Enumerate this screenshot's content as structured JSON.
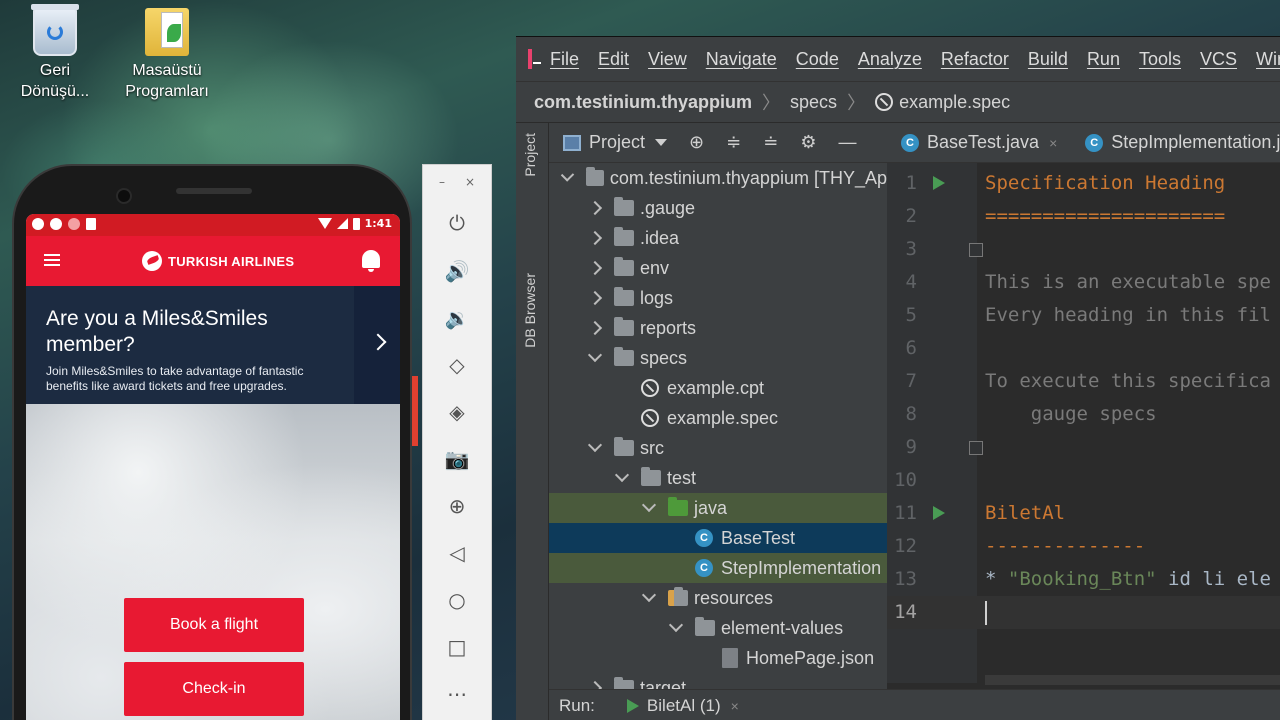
{
  "desktop": {
    "icons": [
      {
        "label_line1": "Geri",
        "label_line2": "Dönüşü...",
        "icon": "recycle-bin-icon"
      },
      {
        "label_line1": "Masaüstü",
        "label_line2": "Programları",
        "icon": "folder-icon"
      }
    ]
  },
  "phone": {
    "status_time": "1:41",
    "app_title": "TURKISH AIRLINES",
    "miles_title": "Are you a Miles&Smiles member?",
    "miles_subtitle": "Join Miles&Smiles to take advantage of fantastic benefits like award tickets and free upgrades.",
    "buttons": [
      "Book a flight",
      "Check-in"
    ]
  },
  "emulator": {
    "window_controls": [
      "–",
      "×"
    ],
    "tools": [
      "power-icon",
      "volume-up-icon",
      "volume-down-icon",
      "rotate-left-icon",
      "rotate-right-icon",
      "camera-icon",
      "zoom-icon",
      "back-icon",
      "home-icon",
      "overview-icon",
      "more-icon"
    ]
  },
  "ide": {
    "menu": [
      "File",
      "Edit",
      "View",
      "Navigate",
      "Code",
      "Analyze",
      "Refactor",
      "Build",
      "Run",
      "Tools",
      "VCS",
      "Win"
    ],
    "breadcrumb": [
      "com.testinium.thyappium",
      "specs",
      "example.spec"
    ],
    "side_tabs": [
      "Project",
      "DB Browser"
    ],
    "project_header": "Project",
    "tree": [
      {
        "label": "com.testinium.thyappium [THY_Ap",
        "indent": 0,
        "arrow": "d",
        "icon": "folder"
      },
      {
        "label": ".gauge",
        "indent": 1,
        "arrow": "r",
        "icon": "folder"
      },
      {
        "label": ".idea",
        "indent": 1,
        "arrow": "r",
        "icon": "folder"
      },
      {
        "label": "env",
        "indent": 1,
        "arrow": "r",
        "icon": "folder"
      },
      {
        "label": "logs",
        "indent": 1,
        "arrow": "r",
        "icon": "folder"
      },
      {
        "label": "reports",
        "indent": 1,
        "arrow": "r",
        "icon": "folder"
      },
      {
        "label": "specs",
        "indent": 1,
        "arrow": "d",
        "icon": "folder"
      },
      {
        "label": "example.cpt",
        "indent": 2,
        "arrow": "",
        "icon": "gauge"
      },
      {
        "label": "example.spec",
        "indent": 2,
        "arrow": "",
        "icon": "gauge"
      },
      {
        "label": "src",
        "indent": 1,
        "arrow": "d",
        "icon": "folder"
      },
      {
        "label": "test",
        "indent": 2,
        "arrow": "d",
        "icon": "folder"
      },
      {
        "label": "java",
        "indent": 3,
        "arrow": "d",
        "icon": "folder-green"
      },
      {
        "label": "BaseTest",
        "indent": 4,
        "arrow": "",
        "icon": "class"
      },
      {
        "label": "StepImplementation",
        "indent": 4,
        "arrow": "",
        "icon": "class"
      },
      {
        "label": "resources",
        "indent": 3,
        "arrow": "d",
        "icon": "folder-res"
      },
      {
        "label": "element-values",
        "indent": 4,
        "arrow": "d",
        "icon": "folder"
      },
      {
        "label": "HomePage.json",
        "indent": 5,
        "arrow": "",
        "icon": "json"
      },
      {
        "label": "target",
        "indent": 1,
        "arrow": "r",
        "icon": "folder"
      }
    ],
    "tabs": [
      {
        "label": "BaseTest.java",
        "close": "×"
      },
      {
        "label": "StepImplementation.j",
        "close": ""
      }
    ],
    "code": [
      {
        "num": "1",
        "text": "Specification Heading",
        "cls": "c-orange",
        "run": true
      },
      {
        "num": "2",
        "text": "=====================",
        "cls": "c-orange"
      },
      {
        "num": "3",
        "text": "",
        "cls": "c-gray",
        "fold": true
      },
      {
        "num": "4",
        "text": "This is an executable spe",
        "cls": "c-gray"
      },
      {
        "num": "5",
        "text": "Every heading in this fil",
        "cls": "c-gray"
      },
      {
        "num": "6",
        "text": "",
        "cls": "c-gray"
      },
      {
        "num": "7",
        "text": "To execute this specifica",
        "cls": "c-gray"
      },
      {
        "num": "8",
        "text": "    gauge specs",
        "cls": "c-gray"
      },
      {
        "num": "9",
        "text": "",
        "cls": "c-gray",
        "fold": true
      },
      {
        "num": "10",
        "text": "",
        "cls": "c-gray"
      },
      {
        "num": "11",
        "text": "BiletAl",
        "cls": "c-orange",
        "run": true
      },
      {
        "num": "12",
        "text": "--------------",
        "cls": "c-orange"
      },
      {
        "num": "13",
        "text": "* \"Booking_Btn\" id li ele",
        "cls": "c-text",
        "step": true
      },
      {
        "num": "14",
        "text": "",
        "cls": "c-text",
        "current": true
      }
    ],
    "run_label": "Run:",
    "run_config": "BiletAl (1)",
    "run_close": "×"
  }
}
